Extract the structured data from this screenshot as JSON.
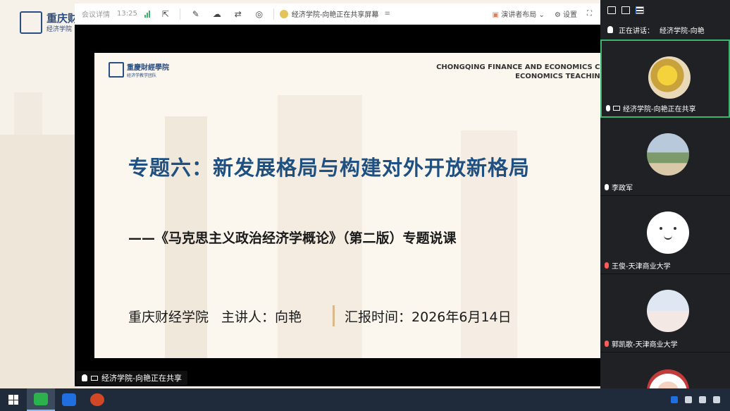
{
  "background": {
    "logo_text": "重庆财",
    "logo_sub": "经济学院"
  },
  "toolbar": {
    "meeting_details": "会议详情",
    "time": "13:25",
    "share_title": "经济学院-向艳正在共享屏幕",
    "layout_label": "演讲者布局",
    "settings_label": "设置"
  },
  "slide": {
    "logo_name": "重慶財經學院",
    "logo_team": "经济学教学团队",
    "english_line1": "CHONGQING FINANCE AND ECONOMICS CO",
    "english_line2": "ECONOMICS TEACHING",
    "title": "专题六：新发展格局与构建对外开放新格局",
    "subtitle": "——《马克思主义政治经济学概论》（第二版）专题说课",
    "footer_school": "重庆财经学院",
    "footer_speaker": "主讲人：向艳",
    "footer_date": "汇报时间：2026年6月14日"
  },
  "presenter_tag": "经济学院-向艳正在共享",
  "panel": {
    "speaking_label": "正在讲话：",
    "speaking_name": "经济学院-向艳",
    "participants": [
      {
        "name": "经济学院-向艳正在共享",
        "muted": false,
        "active": true
      },
      {
        "name": "李政军",
        "muted": false,
        "active": false
      },
      {
        "name": "王俊-天津商业大学",
        "muted": true,
        "active": false
      },
      {
        "name": "郭凯歌-天津商业大学",
        "muted": true,
        "active": false
      }
    ]
  },
  "colors": {
    "title_blue": "#1f5082",
    "active_green": "#3cb46e",
    "panel_bg": "#202124",
    "taskbar_bg": "#1f2b3a"
  }
}
